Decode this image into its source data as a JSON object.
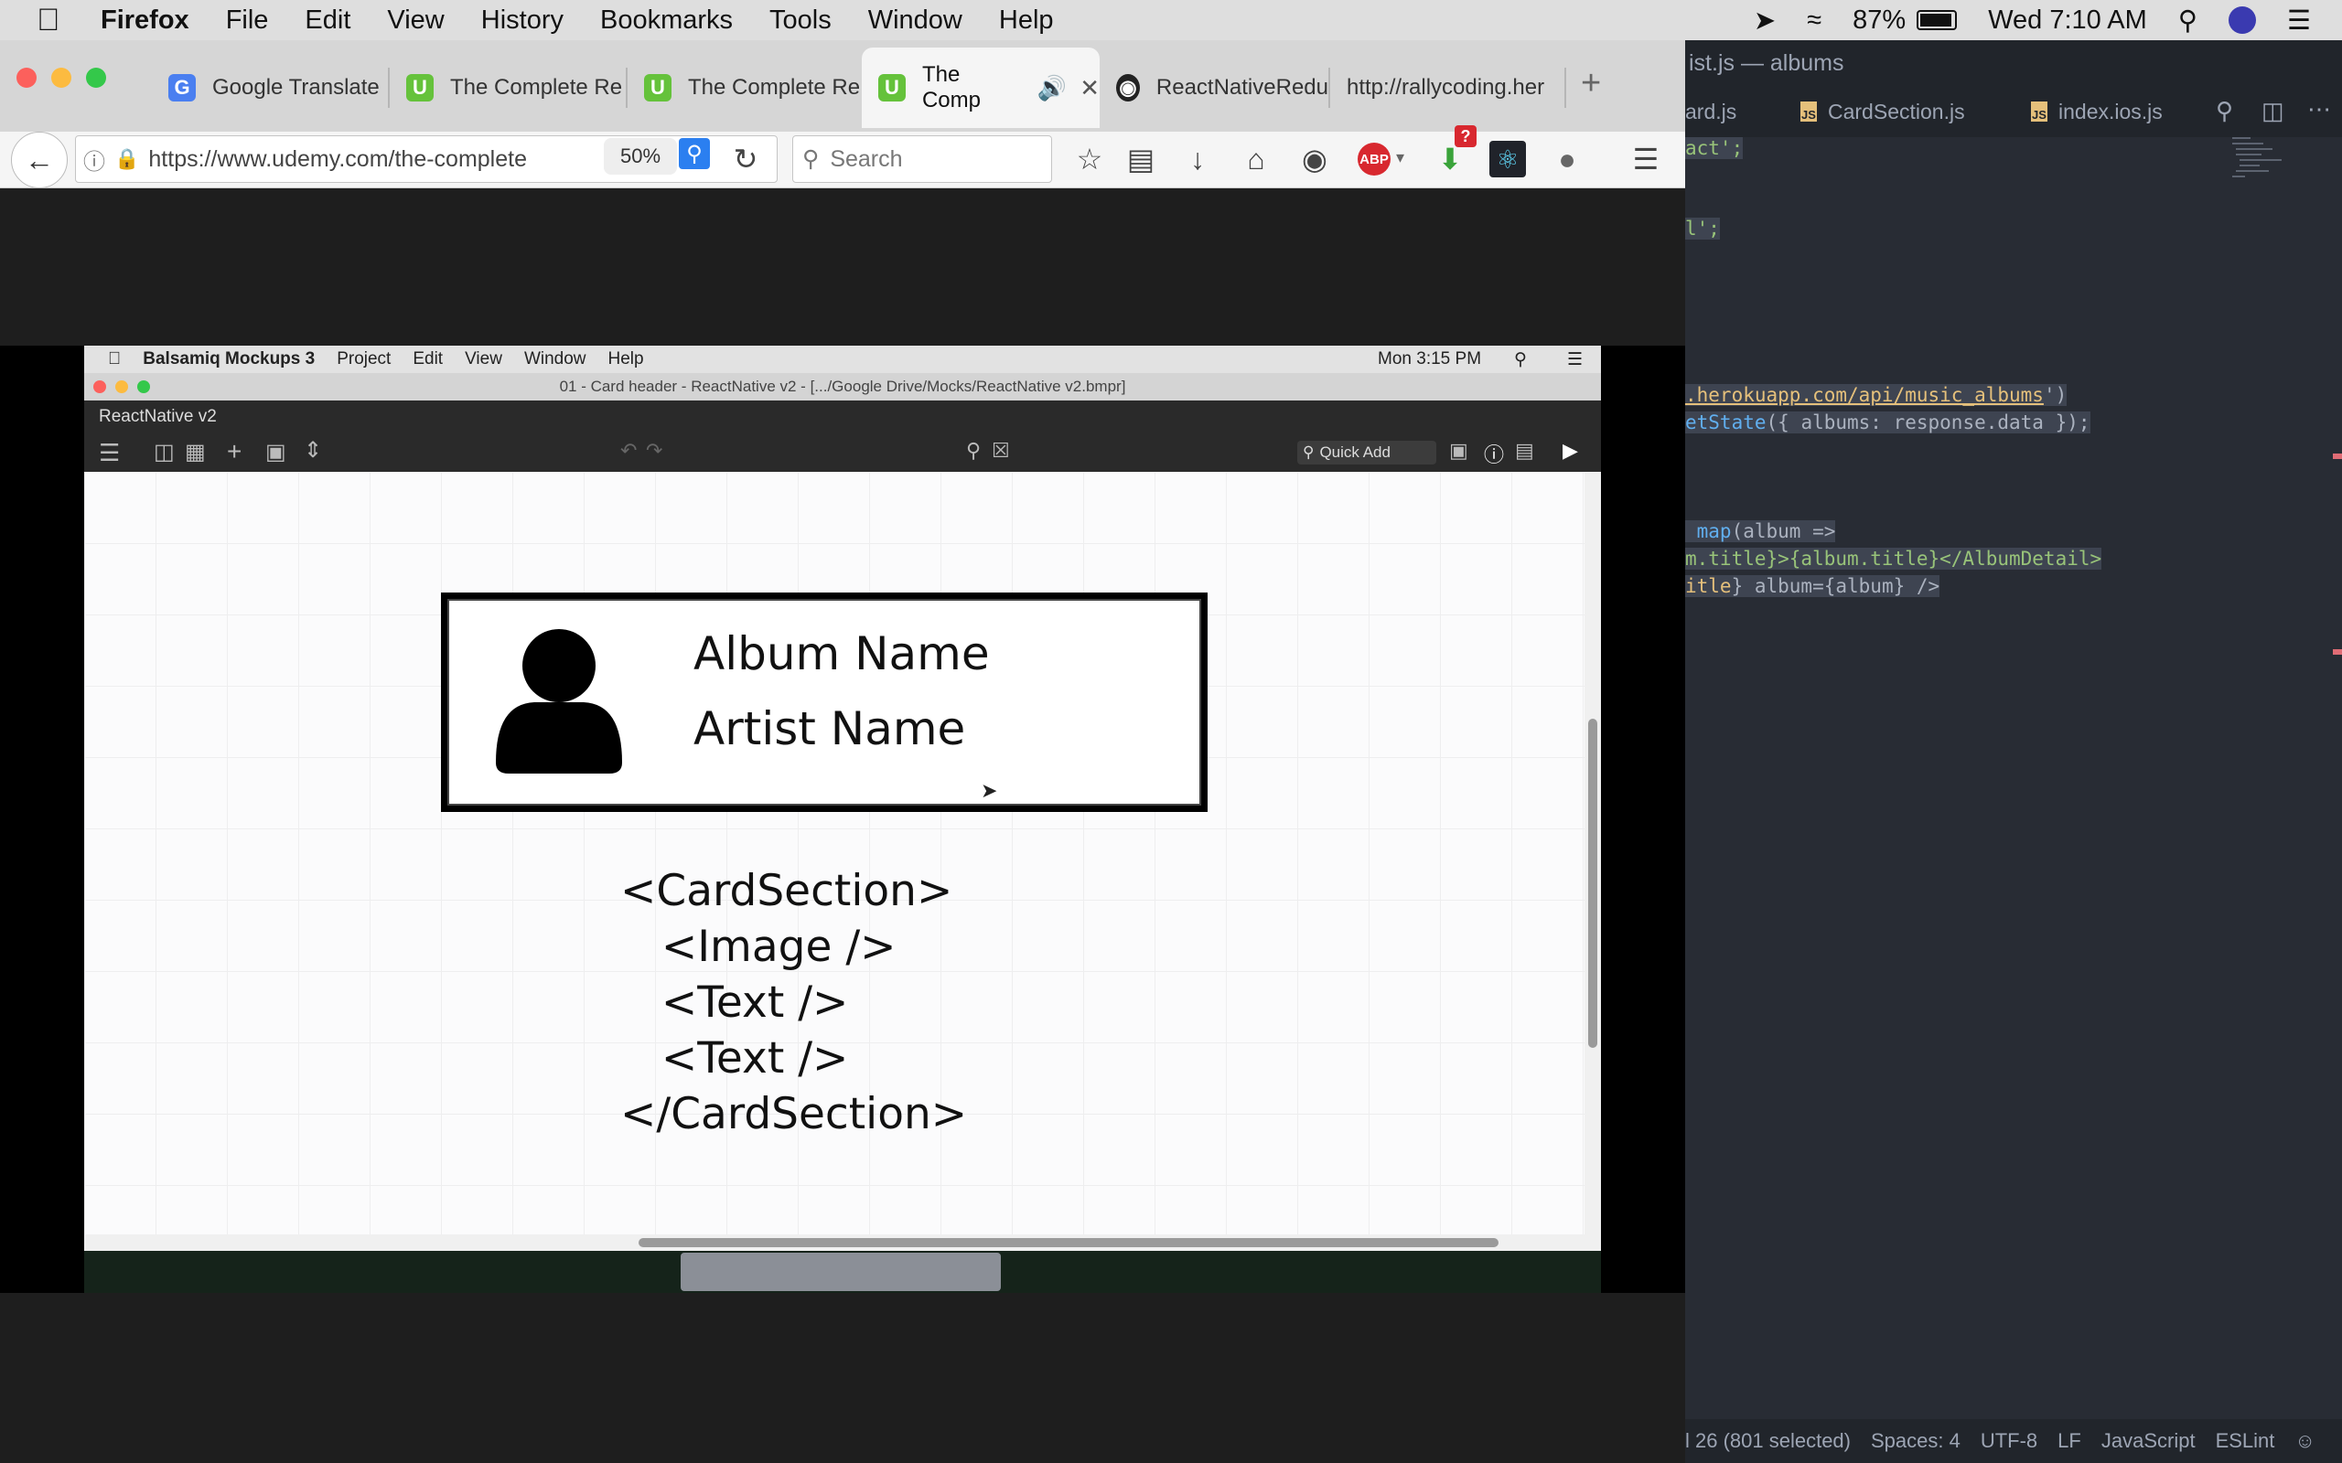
{
  "mac_menubar": {
    "app": "Firefox",
    "menus": [
      "File",
      "Edit",
      "View",
      "History",
      "Bookmarks",
      "Tools",
      "Window",
      "Help"
    ],
    "battery": "87%",
    "clock": "Wed 7:10 AM"
  },
  "browser": {
    "tabs": [
      {
        "label": "Google Translate",
        "icon": "google-translate-icon"
      },
      {
        "label": "The Complete Re",
        "icon": "udemy-icon"
      },
      {
        "label": "The Complete Re",
        "icon": "udemy-icon"
      },
      {
        "label": "The Comp",
        "icon": "udemy-icon",
        "active": true
      },
      {
        "label": "ReactNativeRedu",
        "icon": "github-icon"
      },
      {
        "label": "http://rallycoding.her",
        "icon": ""
      }
    ],
    "url": "https://www.udemy.com/the-complete",
    "zoom": "50%",
    "search_placeholder": "Search",
    "abp_badge": "ABP",
    "download_badge": "?"
  },
  "balsamiq": {
    "menubar": {
      "app": "Balsamiq Mockups 3",
      "menus": [
        "Project",
        "Edit",
        "View",
        "Window",
        "Help"
      ],
      "clock": "Mon 3:15 PM"
    },
    "window_title": "01 - Card header - ReactNative v2 - [.../Google Drive/Mocks/ReactNative v2.bmpr]",
    "project_name": "ReactNative v2",
    "quick_add": "Quick Add",
    "mockup": {
      "album_name": "Album Name",
      "artist_name": "Artist Name",
      "code_lines": [
        "<CardSection>",
        "   <Image />",
        "   <Text />",
        "   <Text />",
        "</CardSection>"
      ]
    }
  },
  "editor": {
    "window_title": "ist.js — albums",
    "tabs": [
      "ard.js",
      "CardSection.js",
      "index.ios.js"
    ],
    "code": {
      "l1": "act';",
      "l2": "l';",
      "l3a": ".herokuapp.com/api/music_albums",
      "l3b": "')",
      "l4a": "etState",
      "l4b": "({ albums: response.data });",
      "l5a": " map",
      "l5b": "(album =>",
      "l6": "m.title}>{album.title}</AlbumDetail>",
      "l7a": "itle",
      "l7b": "} album={album} />"
    },
    "status": {
      "position": "l 26 (801 selected)",
      "indent": "Spaces: 4",
      "encoding": "UTF-8",
      "line_ending": "LF",
      "grammar": "JavaScript",
      "linter": "ESLint"
    }
  }
}
